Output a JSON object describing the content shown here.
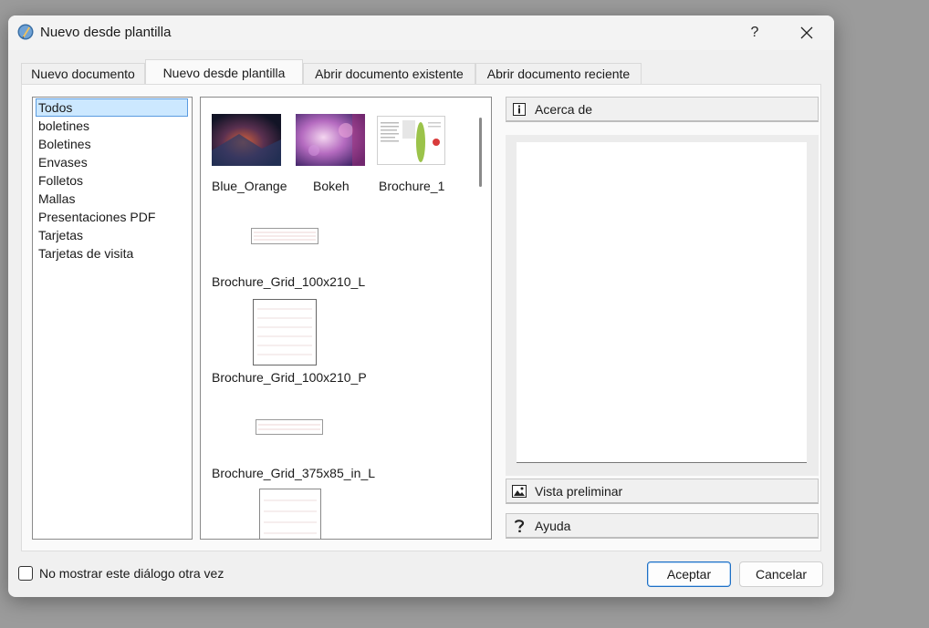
{
  "window": {
    "title": "Nuevo desde plantilla",
    "help_glyph": "?",
    "icon": "scribus-app-icon"
  },
  "tabs": [
    {
      "label": "Nuevo documento",
      "active": false
    },
    {
      "label": "Nuevo desde plantilla",
      "active": true
    },
    {
      "label": "Abrir documento existente",
      "active": false
    },
    {
      "label": "Abrir documento reciente",
      "active": false
    }
  ],
  "categories": {
    "items": [
      "Todos",
      "boletines",
      "Boletines",
      "Envases",
      "Folletos",
      "Mallas",
      "Presentaciones PDF",
      "Tarjetas",
      "Tarjetas de visita"
    ],
    "selected": "Todos"
  },
  "templates": [
    {
      "name": "Blue_Orange"
    },
    {
      "name": "Bokeh"
    },
    {
      "name": "Brochure_1"
    },
    {
      "name": "Brochure_Grid_100x210_L"
    },
    {
      "name": "Brochure_Grid_100x210_P"
    },
    {
      "name": "Brochure_Grid_375x85_in_L"
    },
    {
      "name": ""
    }
  ],
  "side_panel": {
    "about_label": "Acerca de",
    "preview_label": "Vista preliminar",
    "help_label": "Ayuda",
    "about_icon": "info-icon",
    "preview_icon": "image-icon",
    "help_icon": "question-icon"
  },
  "footer": {
    "dont_show_label": "No mostrar este diálogo otra vez",
    "dont_show_checked": false,
    "ok_label": "Aceptar",
    "cancel_label": "Cancelar"
  },
  "colors": {
    "accent": "#1d6fc4",
    "selection_bg": "#cce8ff",
    "selection_border": "#5a9be0"
  }
}
